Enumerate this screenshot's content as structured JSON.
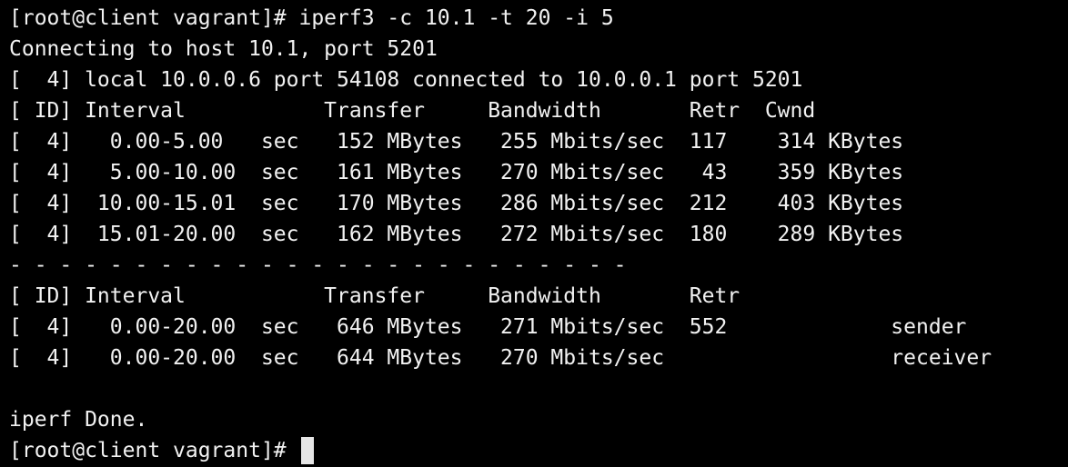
{
  "terminal": {
    "lines": [
      "[root@client vagrant]# iperf3 -c 10.1 -t 20 -i 5",
      "Connecting to host 10.1, port 5201",
      "[  4] local 10.0.0.6 port 54108 connected to 10.0.0.1 port 5201",
      "[ ID] Interval           Transfer     Bandwidth       Retr  Cwnd",
      "[  4]   0.00-5.00   sec   152 MBytes   255 Mbits/sec  117    314 KBytes",
      "[  4]   5.00-10.00  sec   161 MBytes   270 Mbits/sec   43    359 KBytes",
      "[  4]  10.00-15.01  sec   170 MBytes   286 Mbits/sec  212    403 KBytes",
      "[  4]  15.01-20.00  sec   162 MBytes   272 Mbits/sec  180    289 KBytes",
      "- - - - - - - - - - - - - - - - - - - - - - - - -",
      "[ ID] Interval           Transfer     Bandwidth       Retr",
      "[  4]   0.00-20.00  sec   646 MBytes   271 Mbits/sec  552             sender",
      "[  4]   0.00-20.00  sec   644 MBytes   270 Mbits/sec                  receiver",
      "",
      "iperf Done."
    ],
    "prompt": "[root@client vagrant]# ",
    "colors": {
      "background": "#000000",
      "text": "#f2f2f2",
      "cursor": "#e6e6e6"
    }
  }
}
